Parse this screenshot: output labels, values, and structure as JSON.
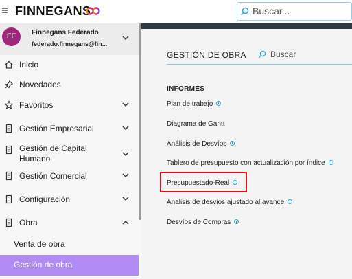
{
  "header": {
    "brand": "FINNEGANS",
    "search_placeholder": "Buscar..."
  },
  "user": {
    "initials": "FF",
    "name": "Finnegans Federado",
    "email": "federado.finnegans@fin..."
  },
  "sidebar": {
    "items": [
      {
        "label": "Inicio",
        "icon": "home-icon"
      },
      {
        "label": "Novedades",
        "icon": "pin-icon"
      },
      {
        "label": "Favoritos",
        "icon": "star-icon"
      },
      {
        "label": "Gestión Empresarial",
        "icon": "building-icon"
      },
      {
        "label": "Gestión de Capital Humano",
        "icon": "building-icon"
      },
      {
        "label": "Gestión Comercial",
        "icon": "building-icon"
      },
      {
        "label": "Configuración",
        "icon": "building-icon"
      },
      {
        "label": "Obra",
        "icon": "building-icon"
      }
    ],
    "sub_items": [
      {
        "label": "Venta de obra"
      },
      {
        "label": "Gestión de obra",
        "active": true
      }
    ]
  },
  "main": {
    "title": "GESTIÓN DE OBRA",
    "search_placeholder": "Buscar",
    "section": "INFORMES",
    "reports": [
      {
        "label": "Plan de trabajo",
        "info": true
      },
      {
        "label": "Diagrama de Gantt",
        "info": false
      },
      {
        "label": "Análisis de Desvíos",
        "info": true
      },
      {
        "label": "Tablero de presupuesto con actualización por índice",
        "info": true
      },
      {
        "label": "Presupuestado-Real",
        "info": true,
        "highlighted": true
      },
      {
        "label": "Analisis de desvios ajustado al avance",
        "info": true
      },
      {
        "label": "Desvíos de Compras",
        "info": true
      }
    ]
  },
  "colors": {
    "accent": "#b18af4",
    "avatar": "#a0267a",
    "search_border": "#8fd0e8",
    "highlight": "#e0141a",
    "info": "#2aa3d6"
  }
}
